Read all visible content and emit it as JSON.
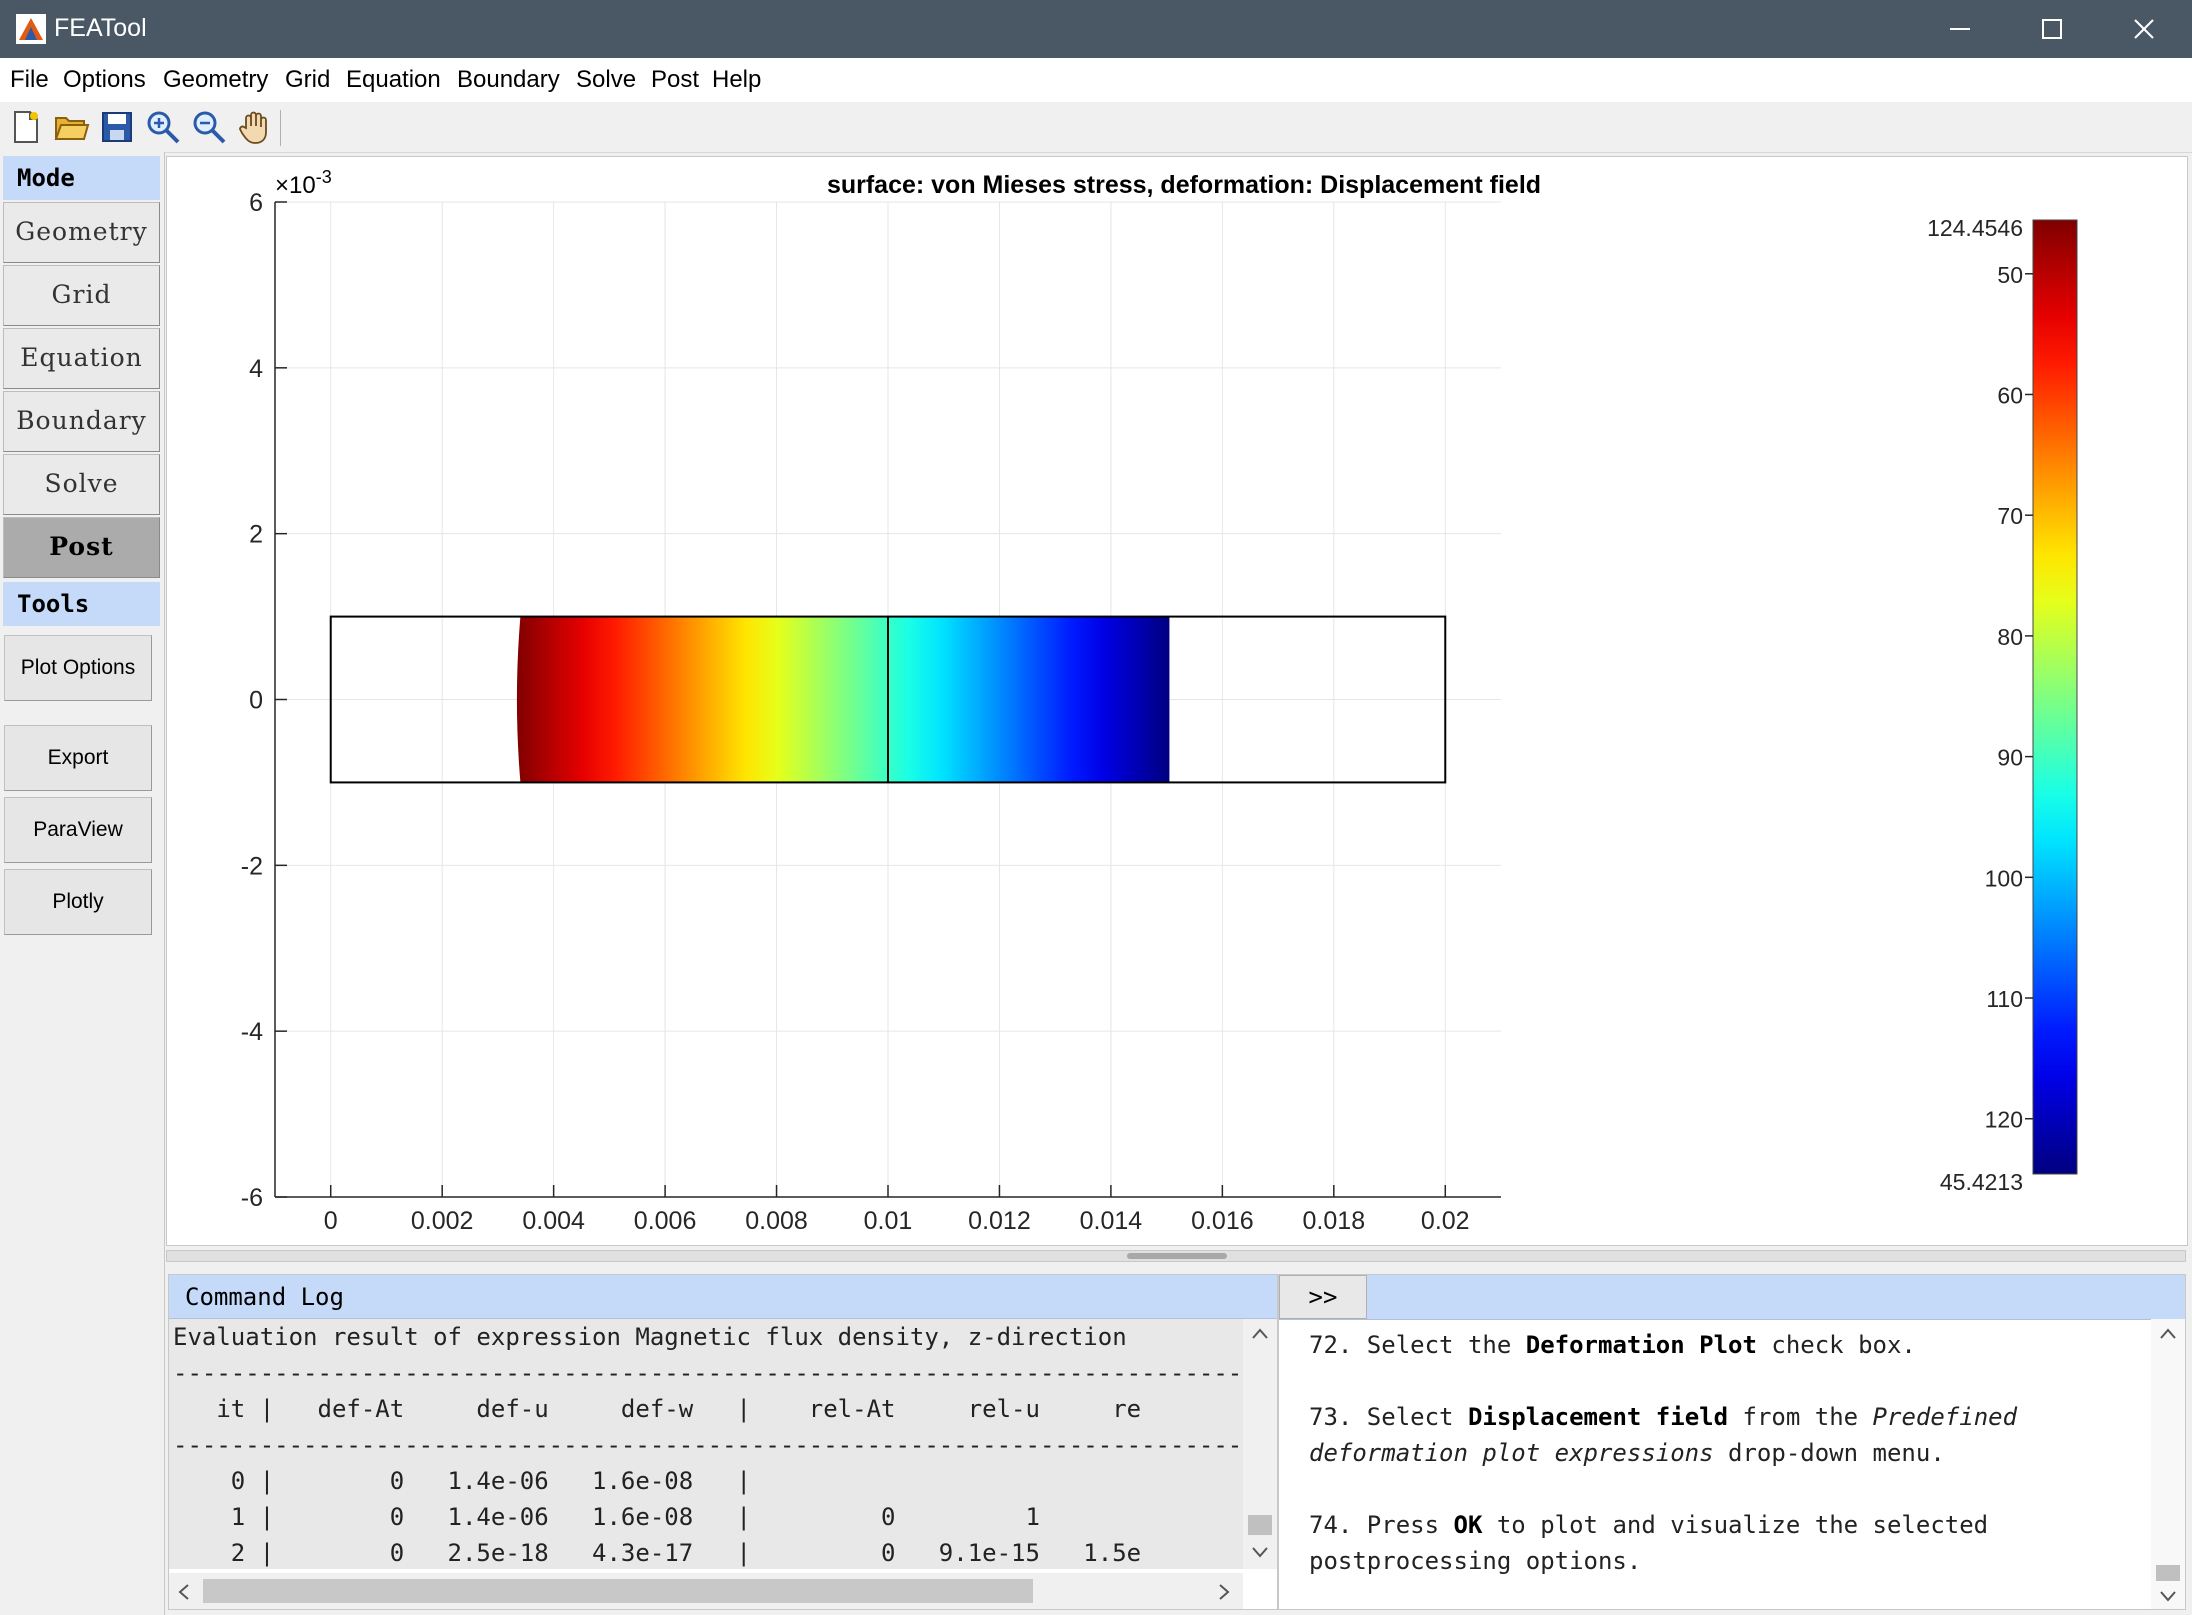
{
  "window": {
    "title": "FEATool"
  },
  "menu": [
    "File",
    "Options",
    "Geometry",
    "Grid",
    "Equation",
    "Boundary",
    "Solve",
    "Post",
    "Help"
  ],
  "toolbar": {
    "icons": [
      "new-file-icon",
      "open-folder-icon",
      "save-icon",
      "zoom-in-icon",
      "zoom-out-icon",
      "pan-hand-icon"
    ]
  },
  "sidebar": {
    "mode_label": "Mode",
    "modes": [
      "Geometry",
      "Grid",
      "Equation",
      "Boundary",
      "Solve",
      "Post"
    ],
    "active_mode": "Post",
    "tools_label": "Tools",
    "tools": [
      "Plot Options",
      "Export",
      "ParaView",
      "Plotly"
    ]
  },
  "plot": {
    "title": "surface: von Mieses stress, deformation: Displacement field",
    "y_exponent_base": "×10",
    "y_exponent_power": "-3",
    "x_ticks": [
      "0",
      "0.002",
      "0.004",
      "0.006",
      "0.008",
      "0.01",
      "0.012",
      "0.014",
      "0.016",
      "0.018",
      "0.02"
    ],
    "y_ticks": [
      "6",
      "4",
      "2",
      "0",
      "-2",
      "-4",
      "-6"
    ],
    "colorbar": {
      "max_label": "124.4546",
      "min_label": "45.4213",
      "ticks": [
        "120",
        "110",
        "100",
        "90",
        "80",
        "70",
        "60",
        "50"
      ],
      "colormap": "jet"
    }
  },
  "chart_data": {
    "type": "heatmap",
    "title": "surface: von Mieses stress, deformation: Displacement field",
    "x_range": [
      -0.001,
      0.021
    ],
    "y_range": [
      -0.006,
      0.006
    ],
    "grid": true,
    "domain_outline": {
      "x": [
        0,
        0.02
      ],
      "y": [
        -0.001,
        0.001
      ]
    },
    "interior_divider_x": 0.01,
    "colored_region_x": [
      0.00335,
      0.01505
    ],
    "stress_range": [
      45.4213,
      124.4546
    ],
    "colorbar_ticks": [
      50,
      60,
      70,
      80,
      90,
      100,
      110,
      120
    ]
  },
  "log": {
    "title": "Command Log",
    "lines": [
      "Evaluation result of expression Magnetic flux density, z-direction",
      "--------------------------------------------------------------------------",
      "   it |   def-At     def-u     def-w   |    rel-At     rel-u     re",
      "--------------------------------------------------------------------------",
      "    0 |        0   1.4e-06   1.6e-08   |",
      "    1 |        0   1.4e-06   1.6e-08   |         0         1",
      "    2 |        0   2.5e-18   4.3e-17   |         0   9.1e-15   1.5e"
    ]
  },
  "help": {
    "expand_label": ">>",
    "step72": {
      "pre": "72. Select the ",
      "bold": "Deformation Plot",
      "post": " check box."
    },
    "step73": {
      "pre": "73. Select ",
      "bold": "Displacement field",
      "mid": " from the ",
      "italic": "Predefined deformation plot expressions",
      "post": " drop-down menu."
    },
    "step74": {
      "pre": "74. Press ",
      "bold": "OK",
      "post": " to plot and visualize the selected postprocessing options."
    }
  }
}
